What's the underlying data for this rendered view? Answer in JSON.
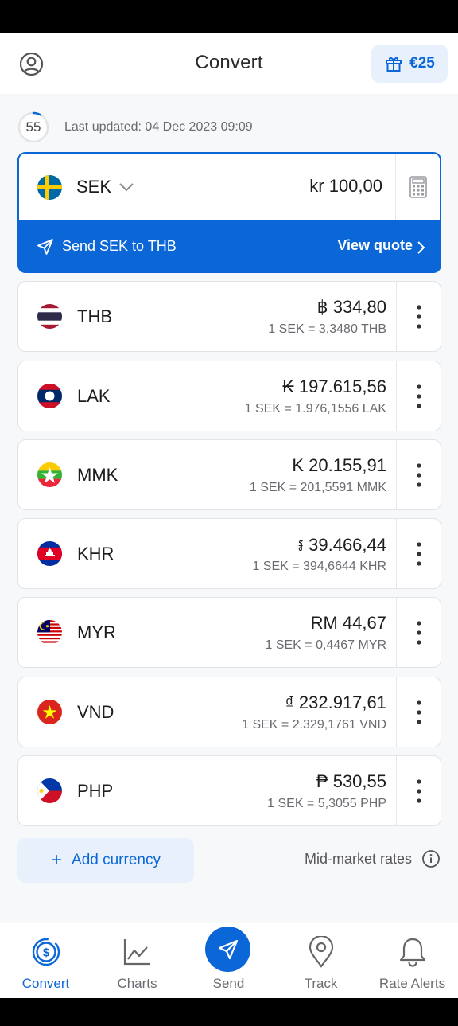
{
  "header": {
    "title": "Convert",
    "gift_value": "€25",
    "profile_icon": "profile-icon",
    "gift_icon": "gift-icon"
  },
  "update": {
    "seconds": "55",
    "last_updated": "Last updated: 04 Dec 2023 09:09",
    "progress_fraction": 0.08
  },
  "base": {
    "code": "SEK",
    "amount": "kr 100,00",
    "send_label": "Send SEK to THB",
    "quote_label": "View quote"
  },
  "currencies": [
    {
      "code": "THB",
      "amount": "฿ 334,80",
      "rate": "1 SEK = 3,3480 THB"
    },
    {
      "code": "LAK",
      "amount": "₭ 197.615,56",
      "rate": "1 SEK = 1.976,1556 LAK"
    },
    {
      "code": "MMK",
      "amount": "K 20.155,91",
      "rate": "1 SEK = 201,5591 MMK"
    },
    {
      "code": "KHR",
      "amount": "៛ 39.466,44",
      "rate": "1 SEK = 394,6644 KHR"
    },
    {
      "code": "MYR",
      "amount": "RM 44,67",
      "rate": "1 SEK = 0,4467 MYR"
    },
    {
      "code": "VND",
      "amount": "₫ 232.917,61",
      "rate": "1 SEK = 2.329,1761 VND"
    },
    {
      "code": "PHP",
      "amount": "₱ 530,55",
      "rate": "1 SEK = 5,3055 PHP"
    }
  ],
  "footer": {
    "add_currency": "Add currency",
    "mid_market": "Mid-market rates"
  },
  "nav": [
    {
      "label": "Convert",
      "icon": "dollar-circle-icon",
      "active": true
    },
    {
      "label": "Charts",
      "icon": "chart-icon",
      "active": false
    },
    {
      "label": "Send",
      "icon": "paper-plane-icon",
      "active": false
    },
    {
      "label": "Track",
      "icon": "location-pin-icon",
      "active": false
    },
    {
      "label": "Rate Alerts",
      "icon": "bell-icon",
      "active": false
    }
  ],
  "colors": {
    "accent": "#0b67d8",
    "accent_light": "#e8f1fb",
    "background": "#f7f8fa"
  }
}
